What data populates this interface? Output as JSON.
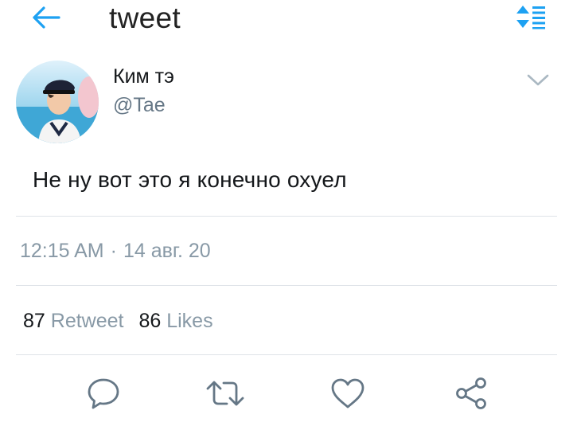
{
  "header": {
    "title": "tweet",
    "back_icon": "arrow-left-icon",
    "sort_icon": "sort-icon",
    "accent_color": "#1da1f2"
  },
  "tweet": {
    "display_name": "Ким тэ",
    "handle": "@Tae",
    "text": "Не ну вот это я конечно охуел",
    "time": "12:15 AM",
    "separator": "·",
    "date": "14 авг. 20",
    "retweet_count": "87",
    "retweet_label": "Retweet",
    "like_count": "86",
    "like_label": "Likes"
  },
  "actions": [
    {
      "name": "reply",
      "icon": "speech-bubble-icon"
    },
    {
      "name": "retweet",
      "icon": "retweet-icon"
    },
    {
      "name": "like",
      "icon": "heart-icon"
    },
    {
      "name": "share",
      "icon": "share-icon"
    }
  ],
  "colors": {
    "text_primary": "#14171a",
    "text_secondary": "#8899a6",
    "icon_gray": "#657786",
    "divider": "#dfe3e8"
  }
}
